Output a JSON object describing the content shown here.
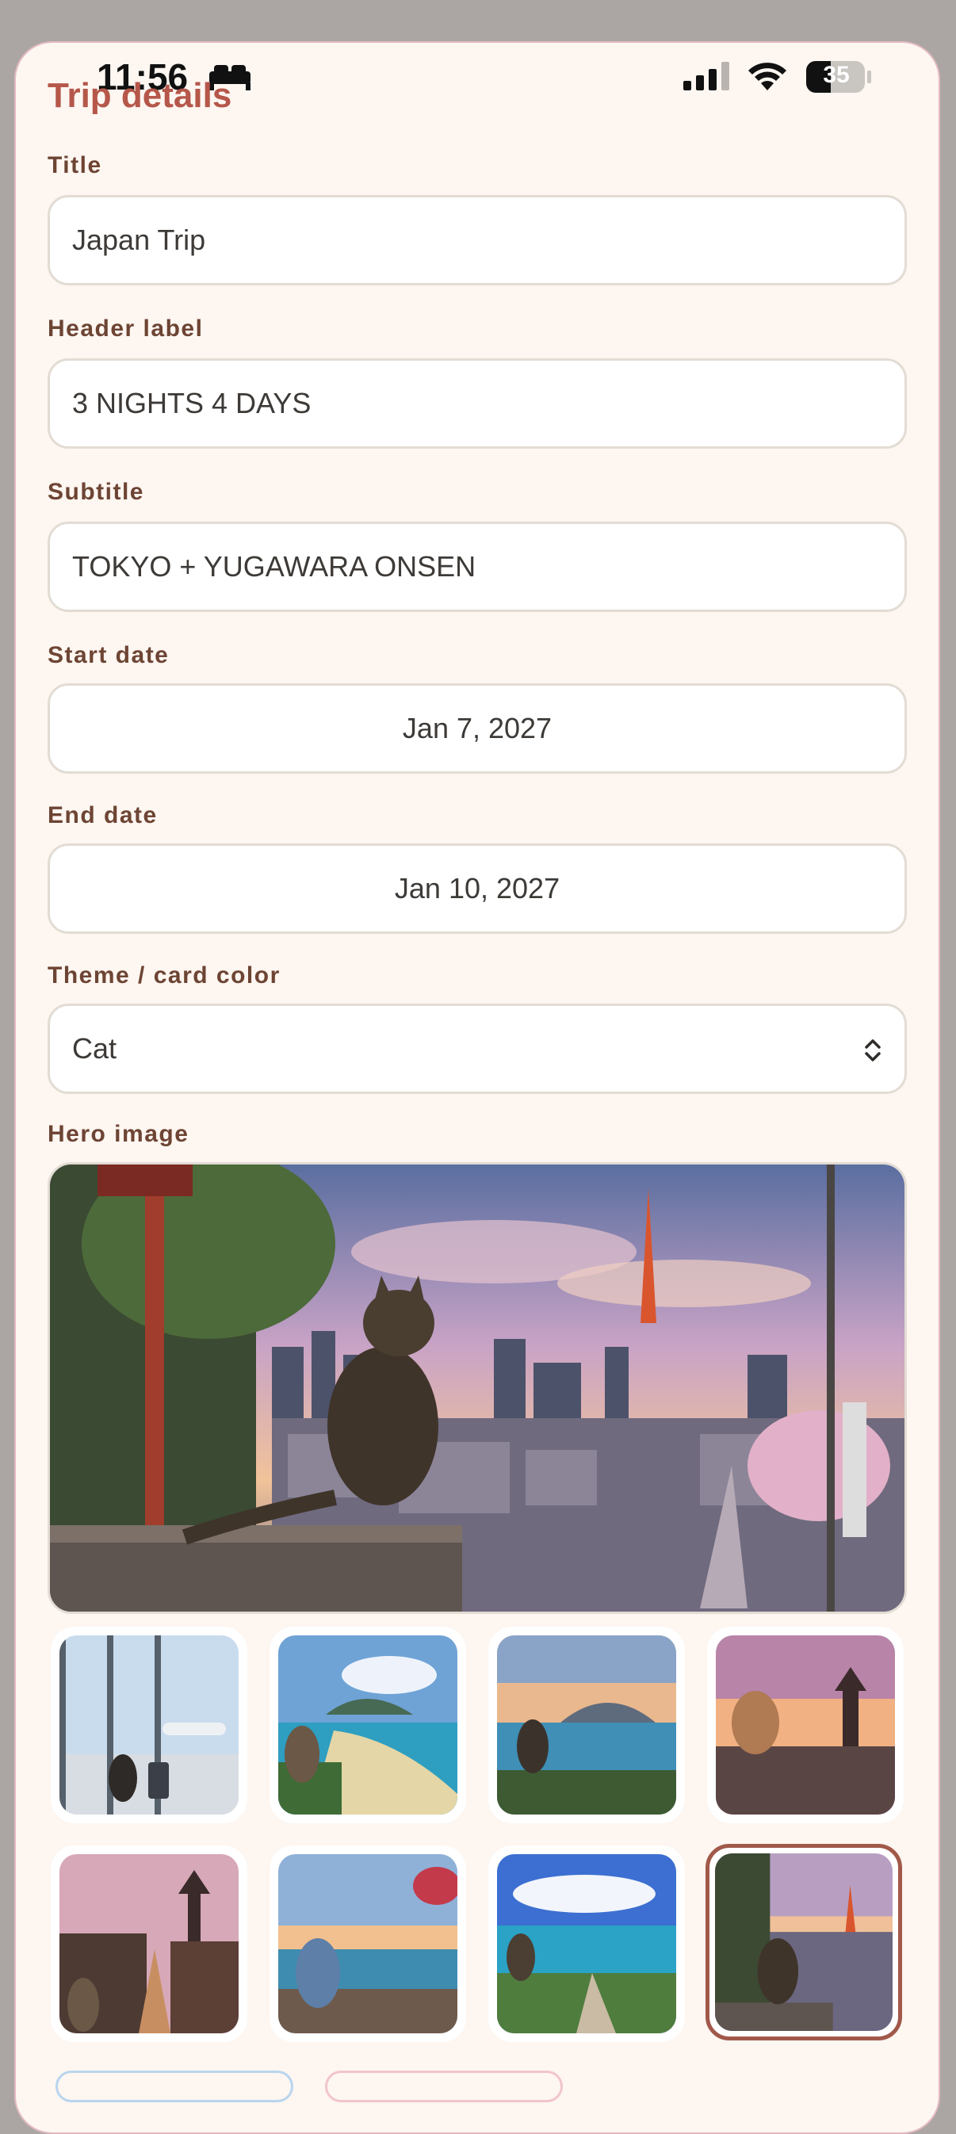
{
  "status_bar": {
    "time": "11:56",
    "battery": "35"
  },
  "form": {
    "heading": "Trip details",
    "title_label": "Title",
    "title_value": "Japan Trip",
    "header_label_label": "Header label",
    "header_label_value": "3 NIGHTS 4 DAYS",
    "subtitle_label": "Subtitle",
    "subtitle_value": "TOKYO + YUGAWARA ONSEN",
    "start_date_label": "Start date",
    "start_date_value": "Jan 7, 2027",
    "end_date_label": "End date",
    "end_date_value": "Jan 10, 2027",
    "theme_label": "Theme / card color",
    "theme_value": "Cat",
    "hero_label": "Hero image"
  },
  "hero_thumbnails": [
    {
      "name": "airport-cat"
    },
    {
      "name": "beach-cat"
    },
    {
      "name": "coast-cat"
    },
    {
      "name": "pagoda-sunset-cat"
    },
    {
      "name": "kyoto-street-cat"
    },
    {
      "name": "kimono-cat-sea"
    },
    {
      "name": "okinawa-cat"
    },
    {
      "name": "tokyo-tower-cat",
      "selected": true
    }
  ],
  "colors": {
    "accent": "#b5574a",
    "label": "#6d4433",
    "selected_border": "#a1594a"
  }
}
